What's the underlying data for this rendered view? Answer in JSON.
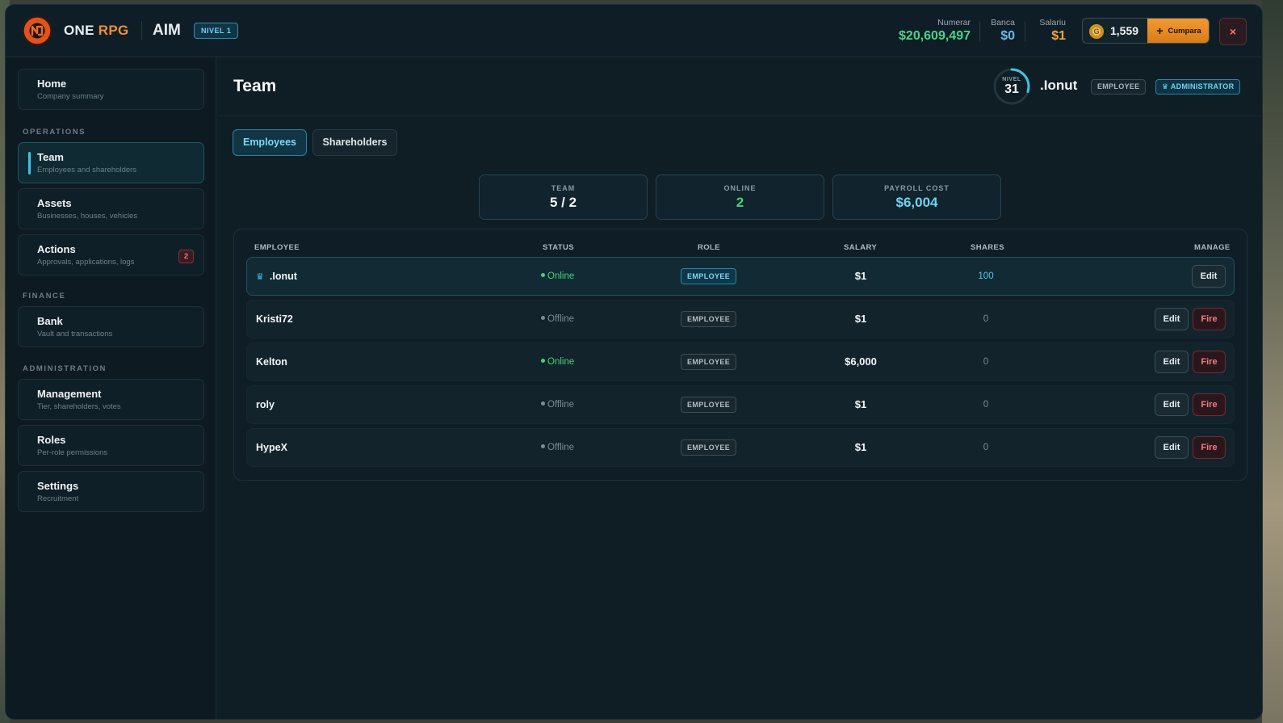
{
  "header": {
    "brand_one": "ONE",
    "brand_rpg": "RPG",
    "company": "AIM",
    "tier": "NIVEL 1",
    "cash_label": "Numerar",
    "cash_value": "$20,609,497",
    "bank_label": "Banca",
    "bank_value": "$0",
    "salary_label": "Salariu",
    "salary_value": "$1",
    "coins_value": "1,559",
    "coin_symbol": "G",
    "buy_label": "Cumpara",
    "buy_plus": "+",
    "close_glyph": "×"
  },
  "sidebar": {
    "home": {
      "title": "Home",
      "subtitle": "Company summary"
    },
    "section_operations": "OPERATIONS",
    "team": {
      "title": "Team",
      "subtitle": "Employees and shareholders"
    },
    "assets": {
      "title": "Assets",
      "subtitle": "Businesses, houses, vehicles"
    },
    "actions": {
      "title": "Actions",
      "subtitle": "Approvals, applications, logs",
      "badge": "2"
    },
    "section_finance": "FINANCE",
    "bank": {
      "title": "Bank",
      "subtitle": "Vault and transactions"
    },
    "section_administration": "ADMINISTRATION",
    "management": {
      "title": "Management",
      "subtitle": "Tier, shareholders, votes"
    },
    "roles": {
      "title": "Roles",
      "subtitle": "Per-role permissions"
    },
    "settings": {
      "title": "Settings",
      "subtitle": "Recruitment"
    }
  },
  "page": {
    "title": "Team",
    "level_label": "NIVEL",
    "level_value": "31",
    "level_progress": 0.3,
    "user_name": ".Ionut",
    "user_role": "EMPLOYEE",
    "user_admin": "ADMINISTRATOR",
    "tab_employees": "Employees",
    "tab_shareholders": "Shareholders"
  },
  "stats": {
    "team_label": "TEAM",
    "team_value": "5 / 2",
    "online_label": "ONLINE",
    "online_value": "2",
    "payroll_label": "PAYROLL COST",
    "payroll_value": "$6,004"
  },
  "table": {
    "col_employee": "EMPLOYEE",
    "col_status": "STATUS",
    "col_role": "ROLE",
    "col_salary": "SALARY",
    "col_shares": "SHARES",
    "col_manage": "MANAGE",
    "edit_label": "Edit",
    "fire_label": "Fire",
    "rows": [
      {
        "name": ".Ionut",
        "status": "Online",
        "role": "EMPLOYEE",
        "salary": "$1",
        "shares": "100"
      },
      {
        "name": "Kristi72",
        "status": "Offline",
        "role": "EMPLOYEE",
        "salary": "$1",
        "shares": "0"
      },
      {
        "name": "Kelton",
        "status": "Online",
        "role": "EMPLOYEE",
        "salary": "$6,000",
        "shares": "0"
      },
      {
        "name": "roly",
        "status": "Offline",
        "role": "EMPLOYEE",
        "salary": "$1",
        "shares": "0"
      },
      {
        "name": "HypeX",
        "status": "Offline",
        "role": "EMPLOYEE",
        "salary": "$1",
        "shares": "0"
      }
    ]
  },
  "colors": {
    "accent": "#3fc2e8",
    "cash": "#4cd28a",
    "bank": "#6fb7e8",
    "salary": "#f0a640",
    "online": "#44d17a",
    "offline": "#7d8b93",
    "danger": "#f07b82"
  }
}
